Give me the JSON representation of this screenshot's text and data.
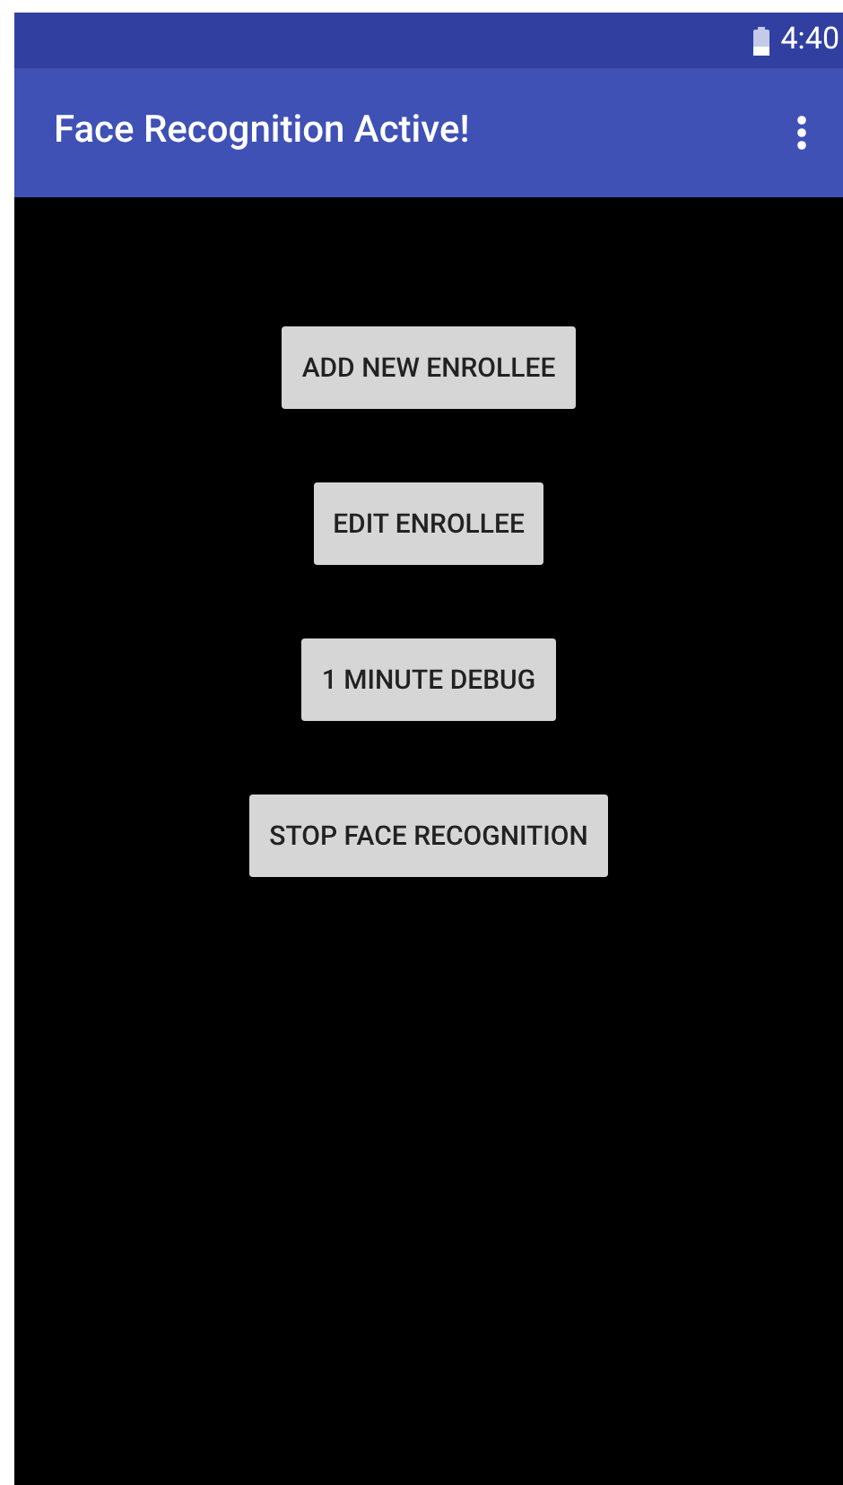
{
  "status_bar": {
    "time": "4:40"
  },
  "app_bar": {
    "title": "Face Recognition Active!"
  },
  "buttons": [
    {
      "label": "ADD NEW ENROLLEE"
    },
    {
      "label": "EDIT ENROLLEE"
    },
    {
      "label": "1 MINUTE DEBUG"
    },
    {
      "label": "STOP FACE RECOGNITION"
    }
  ]
}
